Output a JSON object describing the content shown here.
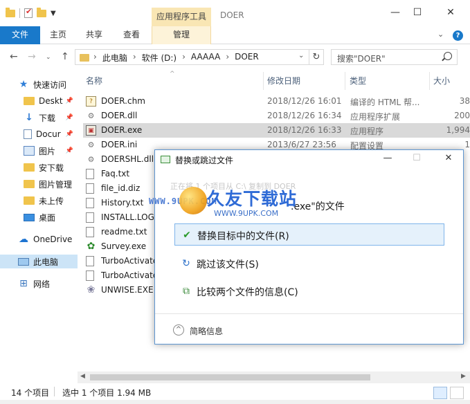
{
  "window": {
    "title": "DOER",
    "context_tab_header": "应用程序工具",
    "controls": [
      "—",
      "☐",
      "✕"
    ]
  },
  "ribbon": {
    "file_tab": "文件",
    "tabs": [
      "主页",
      "共享",
      "查看"
    ],
    "context_tab": "管理",
    "colors": {
      "file_tab": "#1979ca",
      "context": "#f9e6b4"
    }
  },
  "address": {
    "crumbs": [
      "此电脑",
      "软件 (D:)",
      "AAAAA",
      "DOER"
    ],
    "search_placeholder": "搜索\"DOER\""
  },
  "nav": [
    {
      "label": "快速访问",
      "icon": "star-icon"
    },
    {
      "label": "Deskt",
      "icon": "folder-icon",
      "pinned": true
    },
    {
      "label": "下载",
      "icon": "download-icon",
      "pinned": true
    },
    {
      "label": "Docur",
      "icon": "document-icon",
      "pinned": true
    },
    {
      "label": "图片",
      "icon": "picture-icon",
      "pinned": true
    },
    {
      "label": "安下载",
      "icon": "folder-icon"
    },
    {
      "label": "图片管理",
      "icon": "folder-icon"
    },
    {
      "label": "未上传",
      "icon": "folder-icon"
    },
    {
      "label": "桌面",
      "icon": "desktop-icon"
    },
    {
      "label": "OneDrive",
      "icon": "cloud-icon"
    },
    {
      "label": "此电脑",
      "icon": "computer-icon",
      "selected": true
    },
    {
      "label": "网络",
      "icon": "network-icon"
    }
  ],
  "columns": {
    "name": "名称",
    "date": "修改日期",
    "type": "类型",
    "size": "大小"
  },
  "files": [
    {
      "name": "DOER.chm",
      "date": "2018/12/26 16:01",
      "type": "编译的 HTML 帮...",
      "size": "38",
      "icon": "chm-icon"
    },
    {
      "name": "DOER.dll",
      "date": "2018/12/26 16:34",
      "type": "应用程序扩展",
      "size": "200",
      "icon": "dll-icon"
    },
    {
      "name": "DOER.exe",
      "date": "2018/12/26 16:33",
      "type": "应用程序",
      "size": "1,994",
      "icon": "exe-icon",
      "selected": true
    },
    {
      "name": "DOER.ini",
      "date": "2013/6/27 23:56",
      "type": "配置设置",
      "size": "1",
      "icon": "ini-icon"
    },
    {
      "name": "DOERSHL.dll",
      "date": "",
      "type": "",
      "size": "",
      "icon": "dll-icon"
    },
    {
      "name": "Faq.txt",
      "date": "",
      "type": "",
      "size": "",
      "icon": "txt-icon"
    },
    {
      "name": "file_id.diz",
      "date": "",
      "type": "",
      "size": "",
      "icon": "txt-icon"
    },
    {
      "name": "History.txt",
      "date": "",
      "type": "",
      "size": "",
      "icon": "txt-icon"
    },
    {
      "name": "INSTALL.LOG",
      "date": "",
      "type": "",
      "size": "",
      "icon": "txt-icon"
    },
    {
      "name": "readme.txt",
      "date": "",
      "type": "",
      "size": "",
      "icon": "txt-icon"
    },
    {
      "name": "Survey.exe",
      "date": "",
      "type": "",
      "size": "",
      "icon": "survey-icon"
    },
    {
      "name": "TurboActivate",
      "date": "",
      "type": "",
      "size": "",
      "icon": "txt-icon"
    },
    {
      "name": "TurboActivate",
      "date": "",
      "type": "",
      "size": "",
      "icon": "txt-icon"
    },
    {
      "name": "UNWISE.EXE",
      "date": "",
      "type": "",
      "size": "",
      "icon": "wise-icon"
    }
  ],
  "status": {
    "count": "14 个项目",
    "selection": "选中 1 个项目  1.94 MB"
  },
  "dialog": {
    "title": "替换或跳过文件",
    "ghost_line": "正在将 1 个项目从 C:\\ 复制到 DOER",
    "heading_suffix": ".exe\"的文件",
    "options": [
      {
        "label": "替换目标中的文件(R)",
        "icon": "check-icon"
      },
      {
        "label": "跳过该文件(S)",
        "icon": "skip-icon"
      },
      {
        "label": "比较两个文件的信息(C)",
        "icon": "compare-icon"
      }
    ],
    "footer": "简略信息"
  },
  "watermark": {
    "brand": "久友下载站",
    "url_left": "WWW.9UPK.COM",
    "url_bottom": "WWW.9UPK.COM"
  }
}
